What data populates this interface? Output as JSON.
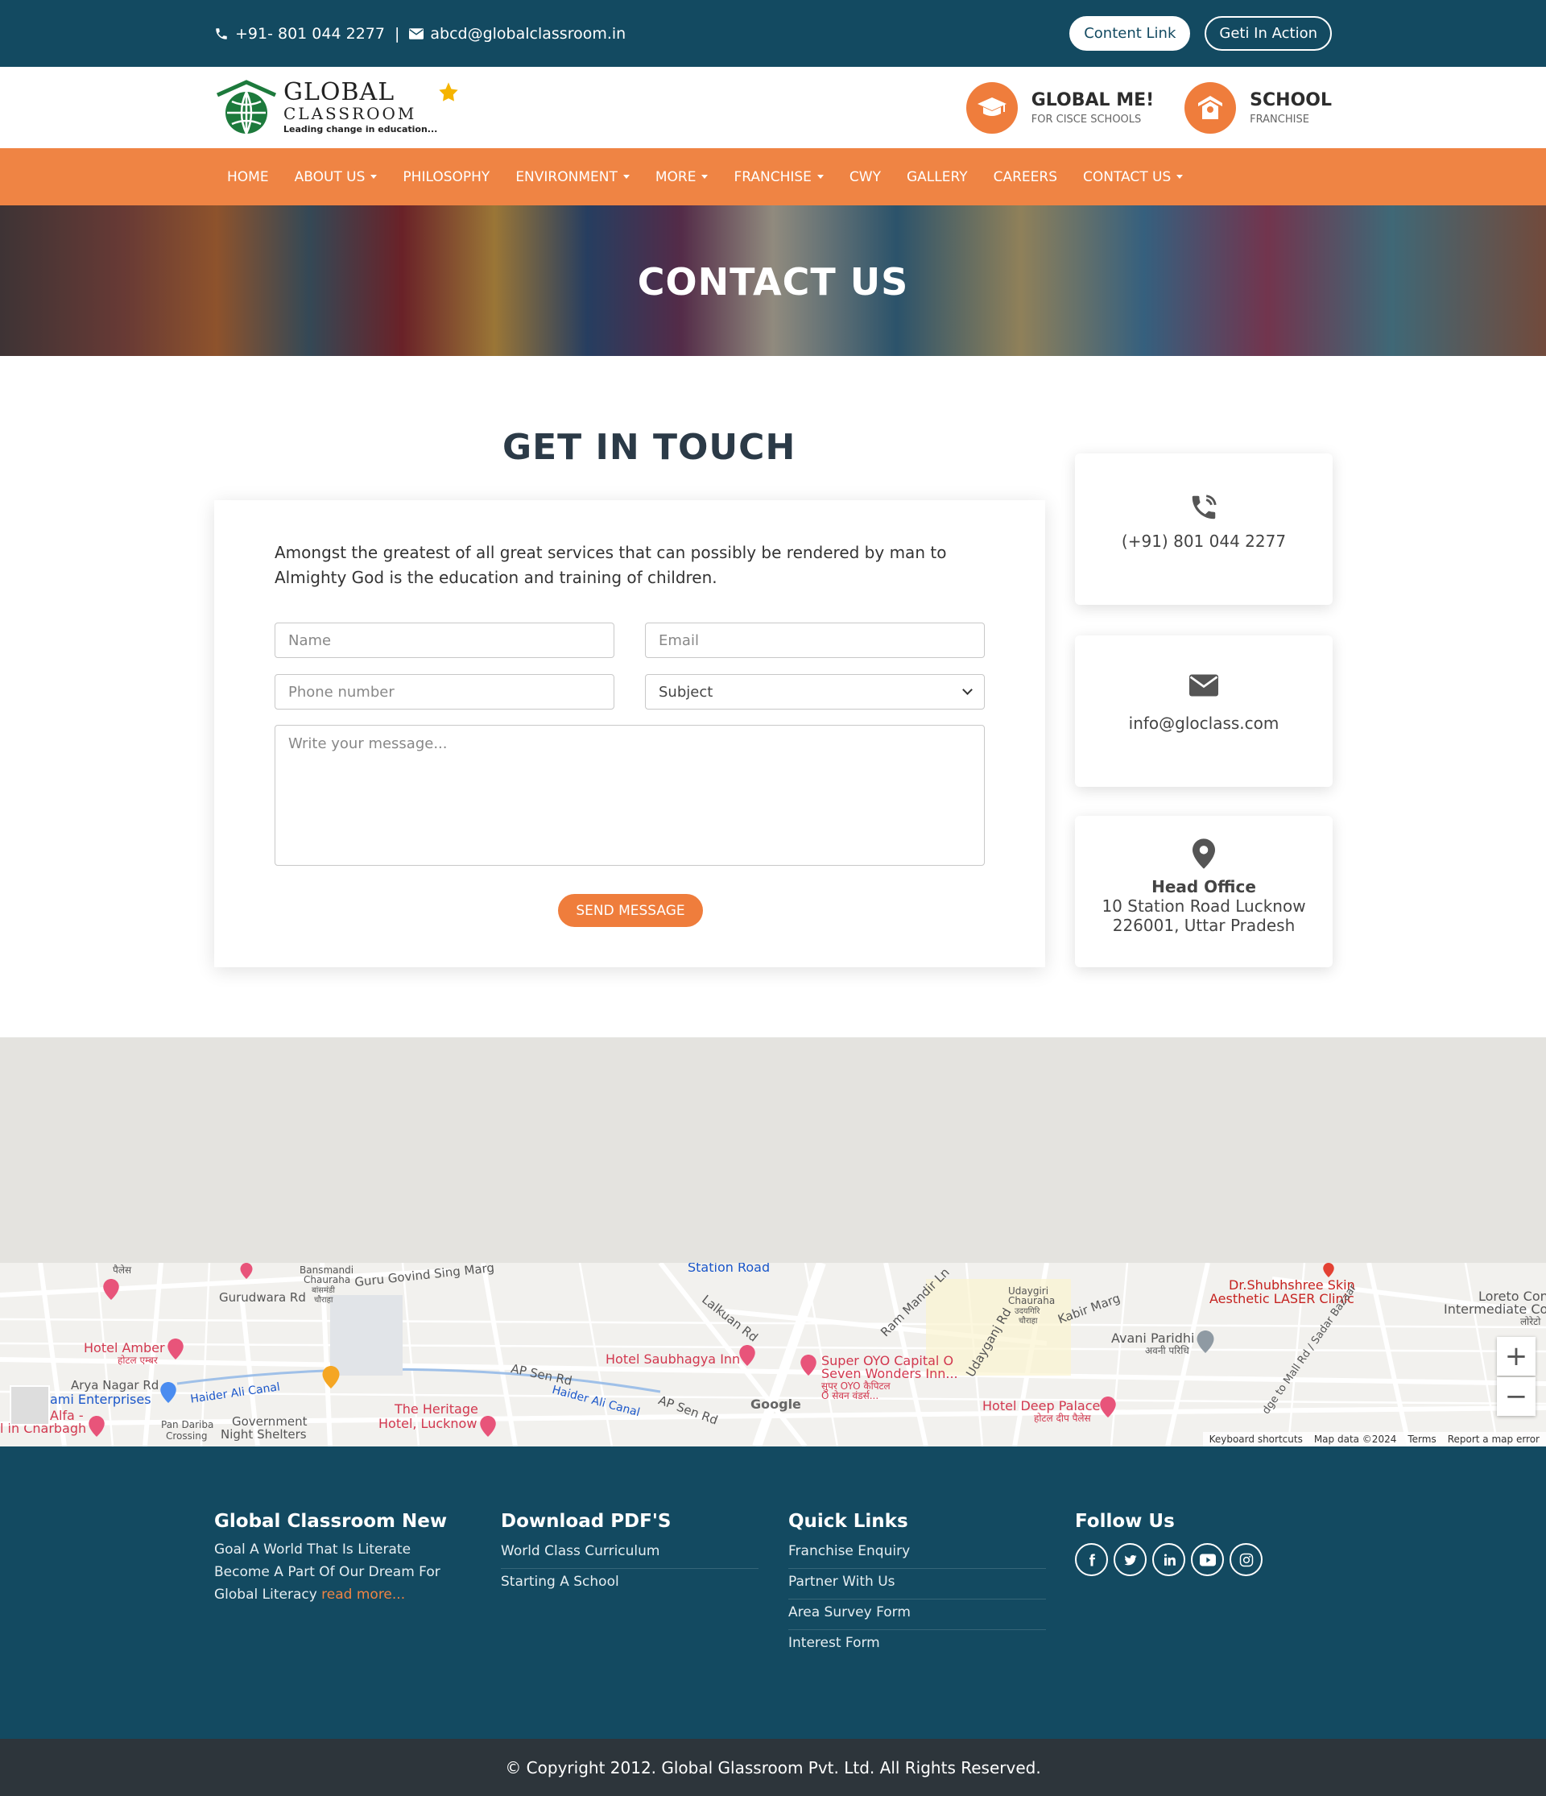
{
  "topbar": {
    "phone": "+91- 801 044 2277",
    "separator": "|",
    "email": "abcd@globalclassroom.in",
    "btn_content": "Content Link",
    "btn_action": "Geti In Action"
  },
  "logo": {
    "line1": "GLOBAL",
    "line2": "CLASSROOM",
    "tagline": "Leading change in education..."
  },
  "badges": [
    {
      "title": "GLOBAL ME!",
      "sub": "FOR CISCE SCHOOLS"
    },
    {
      "title": "SCHOOL",
      "sub": "FRANCHISE"
    }
  ],
  "nav": [
    {
      "label": "HOME",
      "dropdown": false
    },
    {
      "label": "ABOUT US",
      "dropdown": true
    },
    {
      "label": "PHILOSOPHY",
      "dropdown": false
    },
    {
      "label": "ENVIRONMENT",
      "dropdown": true
    },
    {
      "label": "MORE",
      "dropdown": true
    },
    {
      "label": "FRANCHISE",
      "dropdown": true
    },
    {
      "label": "CWY",
      "dropdown": false
    },
    {
      "label": "GALLERY",
      "dropdown": false
    },
    {
      "label": "CAREERS",
      "dropdown": false
    },
    {
      "label": "CONTACT US",
      "dropdown": true
    }
  ],
  "banner": {
    "title": "CONTACT US"
  },
  "contact": {
    "heading": "GET IN TOUCH",
    "intro": "Amongst the greatest of all great services that can possibly be rendered by man to Almighty God is the education and training of children.",
    "name_placeholder": "Name",
    "email_placeholder": "Email",
    "phone_placeholder": "Phone number",
    "subject_value": "Subject",
    "message_placeholder": "Write your message...",
    "send_label": "SEND MESSAGE"
  },
  "info": {
    "phone": "(+91) 801 044 2277",
    "email": "info@gloclass.com",
    "office_title": "Head Office",
    "office_line1": "10 Station Road Lucknow",
    "office_line2": "226001, Uttar Pradesh"
  },
  "map": {
    "labels": {
      "palace_top": "पैलेस",
      "bansmandi": "Bansmandi",
      "chauraha": "Chauraha",
      "bansmandi_hi": "बांसमंडी",
      "chauraha_hi": "चौराहा",
      "guru_govind": "Guru Govind Sing Marg",
      "station_road": "Station Road",
      "gurudwara": "Gurudwara Rd",
      "lalkuan": "Lalkuan Rd",
      "ram_mandir": "Ram Mandir Ln",
      "udaygiri": "Udaygiri",
      "udaygiri2": "Chauraha",
      "udaygiri_hi": "उदयगिरि",
      "udaygiri_hi2": "चौराहा",
      "kabir": "Kabir Marg",
      "dr_skin": "Dr.Shubhshree Skin",
      "dr_skin2": "Aesthetic LASER Clinic",
      "loreto": "Loreto Con",
      "loreto2": "Intermediate Co",
      "loreto_hi": "लोरेटो",
      "hotel_amber": "Hotel Amber",
      "hotel_amber_hi": "होटल एम्बर",
      "ap_sen": "AP Sen Rd",
      "ap_sen2": "AP Sen Rd",
      "saubhagya": "Hotel Saubhagya Inn",
      "avani": "Avani Paridhi",
      "avani_hi": "अवनी परिधि",
      "arya": "Arya Nagar Rd",
      "haider": "Haider Ali Canal",
      "haider2": "Haider Ali Canal",
      "oyo1": "Super OYO Capital O",
      "oyo2": "Seven Wonders Inn...",
      "oyo3": "सुपर OYO कैपिटल",
      "oyo4": "O सेवन वंडर्स...",
      "udayganj": "Udayganj Rd",
      "mall_rd": "dge to Mall Rd / Sadar Bazaar",
      "enterprises": "ami Enterprises",
      "alfa": "Alfa -",
      "charbagh": "l in Charbagh",
      "pan_dariba": "Pan Dariba",
      "crossing": "Crossing",
      "govt": "Government",
      "night": "Night Shelters",
      "heritage": "The Heritage",
      "heritage2": "Hotel, Lucknow",
      "deep_palace": "Hotel Deep Palace",
      "deep_palace_hi": "होटल दीप पैलेस",
      "google": "Google"
    },
    "zoom_in": "+",
    "zoom_out": "−",
    "footer": [
      "Keyboard shortcuts",
      "Map data ©2024",
      "Terms",
      "Report a map error"
    ]
  },
  "footer": {
    "col1_title": "Global Classroom New",
    "col1_text": "Goal A World That Is Literate Become A Part Of Our Dream For Global Literacy",
    "col1_more": "read more...",
    "col2_title": "Download PDF'S",
    "col2_links": [
      "World Class Curriculum",
      "Starting A School"
    ],
    "col3_title": "Quick Links",
    "col3_links": [
      "Franchise Enquiry",
      "Partner With Us",
      "Area Survey Form",
      "Interest Form"
    ],
    "col4_title": "Follow Us",
    "social": [
      "facebook-icon",
      "twitter-icon",
      "linkedin-icon",
      "youtube-icon",
      "instagram-icon"
    ]
  },
  "copyright": "© Copyright 2012. Global Glassroom Pvt. Ltd. All Rights Reserved.",
  "colors": {
    "primary": "#134a61",
    "accent": "#ef8444",
    "dark": "#2d353b"
  }
}
